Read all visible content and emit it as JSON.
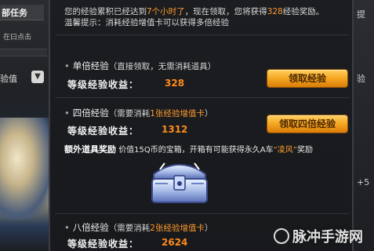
{
  "background": {
    "left_tab": "部任务",
    "left_hint": "在曰点击",
    "left_xp_label": "验值",
    "right_labels": [
      "提",
      "验",
      "+5"
    ]
  },
  "popup": {
    "intro_line1_pre": "您的经验累积已经达到",
    "intro_line1_hl": "7个小时了",
    "intro_line1_mid": "，现在领取，您将获得",
    "intro_line1_hl2": "328",
    "intro_line1_post": "经验奖励。",
    "intro_line2": "温馨提示：消耗经验增值卡可以获得多倍经验",
    "options": [
      {
        "title": "单倍经验",
        "subtitle": "（直接领取，无需消耗道具）",
        "gain_label": "等级经验收益：",
        "gain_value": "328",
        "button": "领取经验"
      },
      {
        "title": "四倍经验",
        "subtitle_pre": "（需要消耗",
        "subtitle_hl": "1张经验增值卡",
        "subtitle_post": "）",
        "gain_label": "等级经验收益：",
        "gain_value": "1312",
        "button": "领取四倍经验"
      },
      {
        "title": "八倍经验",
        "subtitle_pre": "（需要消耗",
        "subtitle_hl": "2张经验增值卡",
        "subtitle_post": "）",
        "gain_label": "等级经验收益：",
        "gain_value": "2624"
      }
    ],
    "extra_label": "额外道具奖励",
    "extra_text_pre": "价值15Q币的宝箱，开箱有可能获得永久A车",
    "extra_text_hl": "“凌风”",
    "extra_text_post": "奖励"
  },
  "watermark": "脉冲手游网"
}
